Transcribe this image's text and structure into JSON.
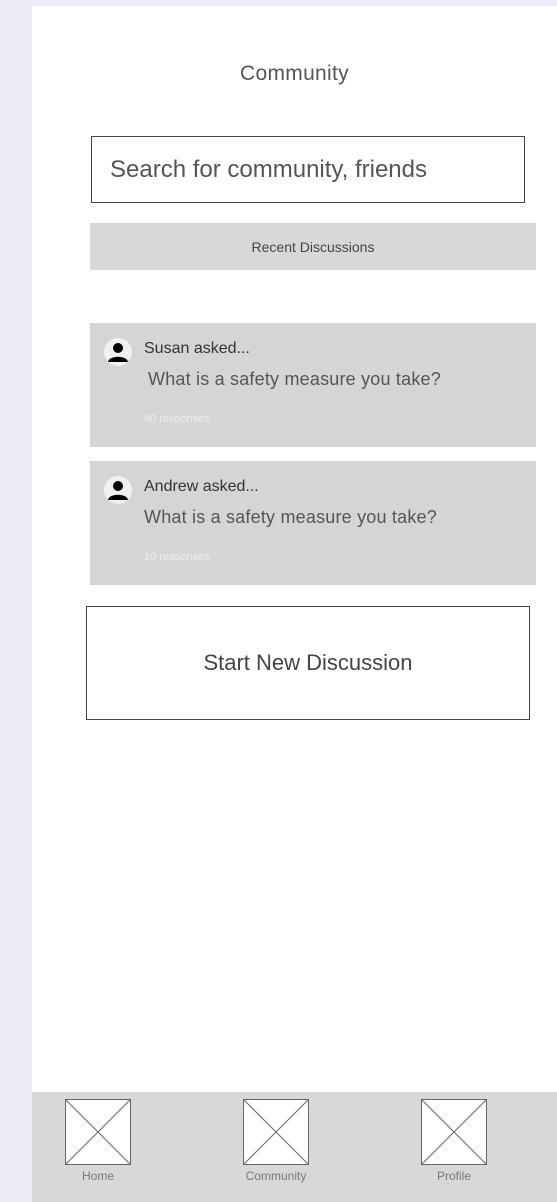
{
  "page": {
    "title": "Community"
  },
  "search": {
    "placeholder": "Search for community, friends",
    "value": ""
  },
  "recent_section": {
    "label": "Recent Discussions"
  },
  "discussions": [
    {
      "asker_label": "Susan asked...",
      "question": "What is a safety measure you take?",
      "responses": "40 responses",
      "avatar_icon": "person-icon"
    },
    {
      "asker_label": "Andrew asked...",
      "question": "What is a safety measure you take?",
      "responses": "10 responses",
      "avatar_icon": "person-icon"
    }
  ],
  "actions": {
    "start_discussion_label": "Start New Discussion"
  },
  "bottom_nav": {
    "items": [
      {
        "label": "Home",
        "icon": "image-placeholder-icon"
      },
      {
        "label": "Community",
        "icon": "image-placeholder-icon"
      },
      {
        "label": "Profile",
        "icon": "image-placeholder-icon"
      }
    ]
  },
  "colors": {
    "page_background": "#ececf7",
    "screen_background": "#ffffff",
    "card_background": "#d5d5d5",
    "nav_background": "#d8d8d8"
  }
}
